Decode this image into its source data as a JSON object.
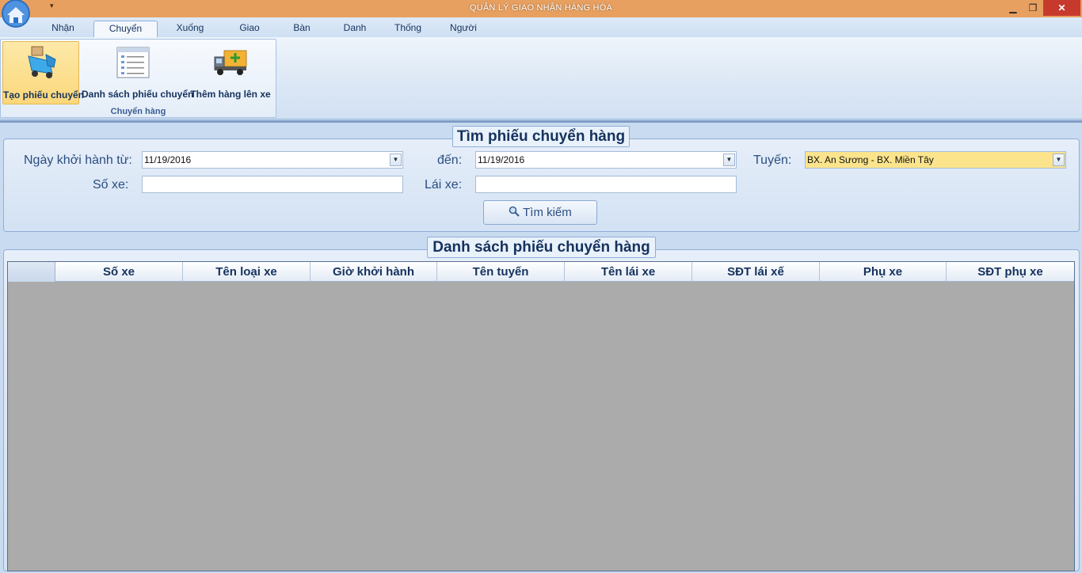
{
  "window": {
    "title": "QUẢN LÝ GIAO NHẬN HÀNG HÓA",
    "qat_icon": "dropdown-arrow",
    "controls": {
      "minimize": "▁",
      "maximize": "❐",
      "close": "✕"
    }
  },
  "ribbon": {
    "tabs": [
      "Nhận hàng",
      "Chuyển hàng",
      "Xuống hàng",
      "Giao hàng",
      "Bàn giao",
      "Danh mục",
      "Thống kê",
      "Người dùng"
    ],
    "active_tab": "Chuyển hàng",
    "group": {
      "label": "Chuyển hàng",
      "buttons": [
        {
          "label": "Tạo phiếu chuyển",
          "icon": "truck-box-icon"
        },
        {
          "label": "Danh sách phiếu chuyển",
          "icon": "list-window-icon"
        },
        {
          "label": "Thêm hàng lên xe",
          "icon": "truck-add-icon"
        }
      ]
    }
  },
  "search": {
    "title": "Tìm phiếu chuyển hàng",
    "date_from_label": "Ngày khởi hành từ:",
    "date_from": "11/19/2016",
    "date_to_label": "đến:",
    "date_to": "11/19/2016",
    "route_label": "Tuyến:",
    "route": "BX. An Sương - BX. Miền Tây",
    "plate_label": "Số xe:",
    "plate": "",
    "driver_label": "Lái xe:",
    "driver": "",
    "search_button": "Tìm kiếm",
    "search_icon": "magnifier-icon"
  },
  "list": {
    "title": "Danh sách phiếu chuyển hàng",
    "columns": [
      "Số xe",
      "Tên loại xe",
      "Giờ khởi hành",
      "Tên tuyến",
      "Tên lái xe",
      "SĐT lái xế",
      "Phụ xe",
      "SĐT phụ xe"
    ],
    "rows": []
  },
  "colors": {
    "titlebar": "#e8a060",
    "close_button": "#c7392d",
    "active_button": "#fbd77a",
    "route_highlight": "#fbe48c",
    "grid_empty": "#ababab"
  }
}
